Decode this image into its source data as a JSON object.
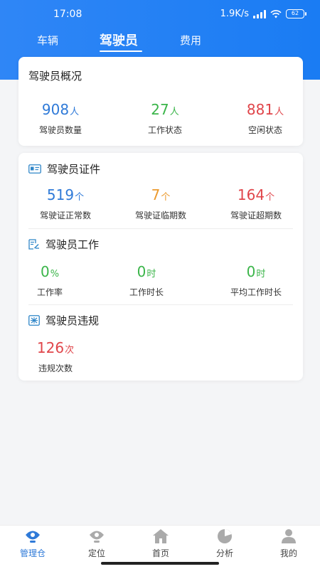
{
  "status": {
    "time": "17:08",
    "net_speed": "1.9K/s",
    "battery": "62"
  },
  "tabs": [
    {
      "label": "车辆",
      "active": false
    },
    {
      "label": "驾驶员",
      "active": true
    },
    {
      "label": "费用",
      "active": false
    }
  ],
  "overview": {
    "title": "驾驶员概况",
    "stats": [
      {
        "value": "908",
        "unit": "人",
        "label": "驾驶员数量",
        "color": "#2f7ad8"
      },
      {
        "value": "27",
        "unit": "人",
        "label": "工作状态",
        "color": "#3bb54a"
      },
      {
        "value": "881",
        "unit": "人",
        "label": "空闲状态",
        "color": "#e0454a"
      }
    ]
  },
  "license": {
    "title": "驾驶员证件",
    "icon": "id-card-icon",
    "stats": [
      {
        "value": "519",
        "unit": "个",
        "label": "驾驶证正常数",
        "color": "#2f7ad8"
      },
      {
        "value": "7",
        "unit": "个",
        "label": "驾驶证临期数",
        "color": "#ec9a2e"
      },
      {
        "value": "164",
        "unit": "个",
        "label": "驾驶证超期数",
        "color": "#e0454a"
      }
    ]
  },
  "work": {
    "title": "驾驶员工作",
    "icon": "work-doc-icon",
    "stats": [
      {
        "value": "0",
        "unit": "%",
        "label": "工作率",
        "color": "#3bb54a"
      },
      {
        "value": "0",
        "unit": "时",
        "label": "工作时长",
        "color": "#3bb54a"
      },
      {
        "value": "0",
        "unit": "时",
        "label": "平均工作时长",
        "color": "#3bb54a"
      }
    ]
  },
  "violation": {
    "title": "驾驶员违规",
    "icon": "violation-icon",
    "stats": [
      {
        "value": "126",
        "unit": "次",
        "label": "违规次数",
        "color": "#e0454a"
      }
    ]
  },
  "bottom_nav": [
    {
      "label": "管理仓",
      "icon": "location-pin-icon",
      "active": true
    },
    {
      "label": "定位",
      "icon": "location-icon",
      "active": false
    },
    {
      "label": "首页",
      "icon": "home-icon",
      "active": false
    },
    {
      "label": "分析",
      "icon": "pie-chart-icon",
      "active": false
    },
    {
      "label": "我的",
      "icon": "user-icon",
      "active": false
    }
  ],
  "colors": {
    "primary": "#1a7cf3",
    "blue": "#2f7ad8",
    "green": "#3bb54a",
    "red": "#e0454a",
    "orange": "#ec9a2e"
  }
}
